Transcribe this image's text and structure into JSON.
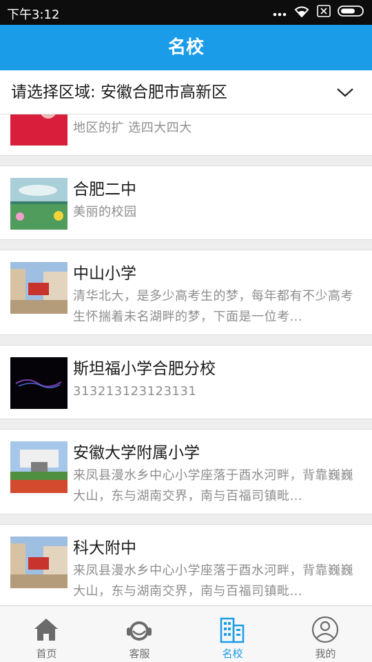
{
  "status_bar": {
    "time": "下午3:12"
  },
  "header": {
    "title": "名校"
  },
  "region_selector": {
    "label": "请选择区域:  安徽合肥市高新区"
  },
  "schools": [
    {
      "name": "",
      "desc": "地区的扩 选四大四大"
    },
    {
      "name": "合肥二中",
      "desc": "美丽的校园"
    },
    {
      "name": "中山小学",
      "desc": "清华北大，是多少高考生的梦，每年都有不少高考生怀揣着未名湖畔的梦，下面是一位考…"
    },
    {
      "name": "斯坦福小学合肥分校",
      "desc": "313213123123131"
    },
    {
      "name": "安徽大学附属小学",
      "desc": "来凤县漫水乡中心小学座落于酉水河畔，背靠巍巍大山，东与湖南交界，南与百福司镇毗…"
    },
    {
      "name": "科大附中",
      "desc": "来凤县漫水乡中心小学座落于酉水河畔，背靠巍巍大山，东与湖南交界，南与百福司镇毗…"
    }
  ],
  "tabbar": {
    "home": "首页",
    "service": "客服",
    "schools": "名校",
    "mine": "我的",
    "active": "schools"
  },
  "colors": {
    "accent": "#1a9ce8",
    "status_bar": "#0d0d0d"
  }
}
